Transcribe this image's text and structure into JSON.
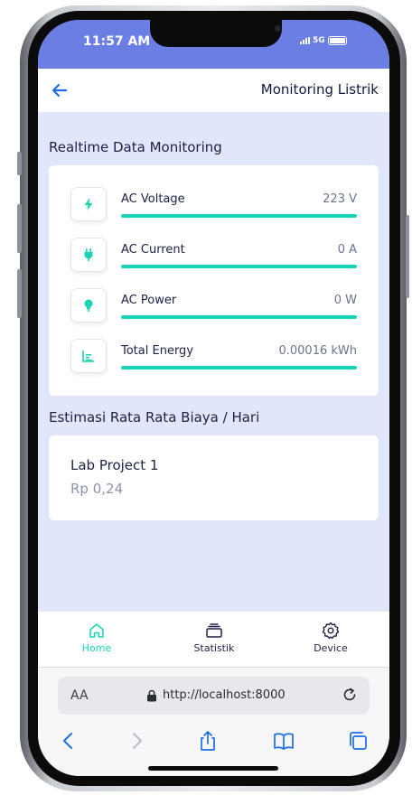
{
  "status_bar": {
    "time": "11:57 AM",
    "network": "5G"
  },
  "header": {
    "title": "Monitoring Listrik"
  },
  "realtime": {
    "title": "Realtime Data Monitoring",
    "metrics": [
      {
        "label": "AC Voltage",
        "value": "223 V",
        "icon": "lightning-icon",
        "fill": 1.0
      },
      {
        "label": "AC Current",
        "value": "0 A",
        "icon": "plug-icon",
        "fill": 1.0
      },
      {
        "label": "AC Power",
        "value": "0 W",
        "icon": "bulb-icon",
        "fill": 1.0
      },
      {
        "label": "Total Energy",
        "value": "0.00016 kWh",
        "icon": "bar-chart-icon",
        "fill": 1.0
      }
    ]
  },
  "estimate": {
    "title": "Estimasi Rata Rata Biaya / Hari",
    "name": "Lab Project 1",
    "value": "Rp 0,24"
  },
  "nav": {
    "items": [
      {
        "label": "Home",
        "icon": "home-icon",
        "active": true
      },
      {
        "label": "Statistik",
        "icon": "stack-icon",
        "active": false
      },
      {
        "label": "Device",
        "icon": "gear-icon",
        "active": false
      }
    ]
  },
  "browser": {
    "aa_label": "AA",
    "url": "http://localhost:8000"
  },
  "colors": {
    "accent": "#17d5b3",
    "primary": "#6a7ee3",
    "background": "#e1e6fb",
    "link": "#1b6ee8"
  }
}
